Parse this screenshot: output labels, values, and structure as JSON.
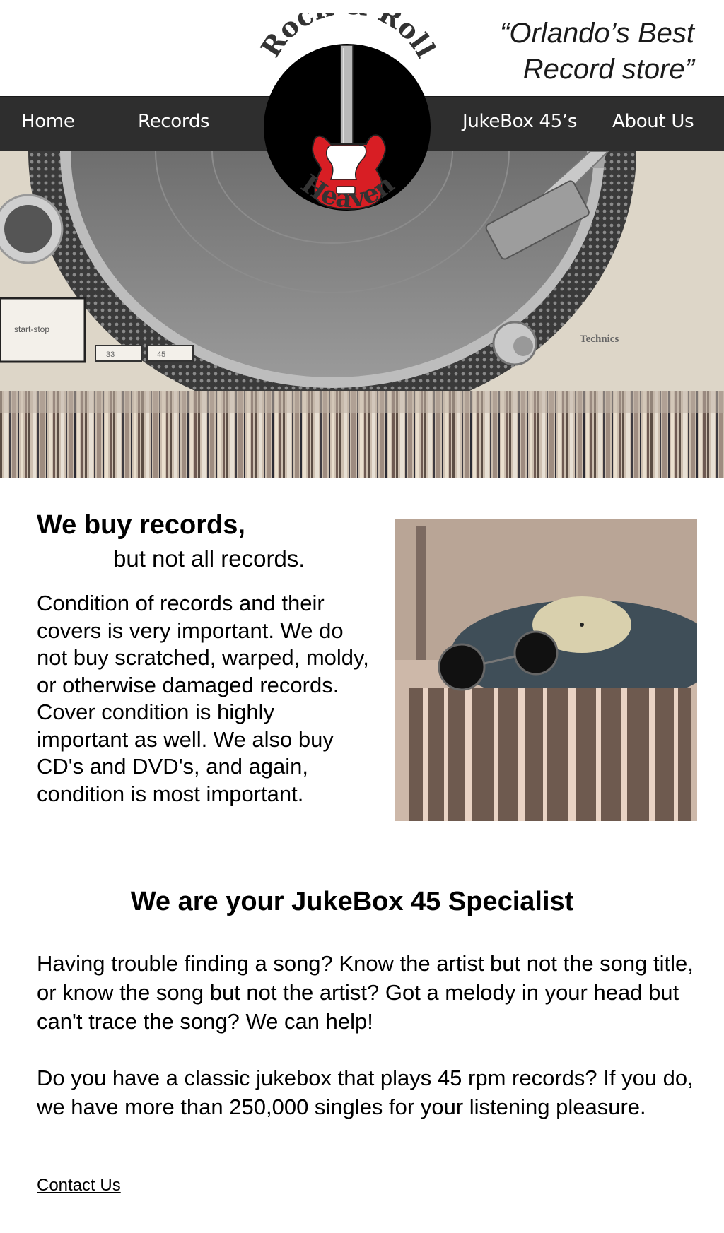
{
  "tagline": {
    "line1": "“Orlando’s Best",
    "line2": "Record store”"
  },
  "logo": {
    "top_text": "Rock & Roll",
    "bottom_text": "Heaven"
  },
  "nav": {
    "home": "Home",
    "records": "Records",
    "jukebox": "JukeBox 45’s",
    "about": "About Us"
  },
  "hero": {
    "button_label": "start-stop",
    "speed_33": "33",
    "speed_45": "45",
    "brand": "Technics"
  },
  "section1": {
    "heading": "We buy records,",
    "subheading": "but not all records.",
    "body": "Condition of records and their covers is very important.  We do not buy scratched, warped, moldy, or otherwise damaged records.  Cover condition is highly important as well.  We also buy CD's and DVD's, and again, condition is most important."
  },
  "section2": {
    "heading": "We are your JukeBox 45 Specialist",
    "para1": "Having trouble finding a song? Know the artist but not the song title, or know the song but not the artist? Got a melody in your head but can't trace the song? We can help!",
    "para2": "Do you have a classic jukebox that plays 45 rpm records? If you do, we have more than 250,000 singles for your listening pleasure.",
    "contact": "Contact Us"
  },
  "colors": {
    "nav_bg": "#2e2e2e",
    "logo_red": "#d81e24",
    "logo_black": "#000000"
  },
  "icons": {
    "logo": "guitar-record-logo"
  }
}
